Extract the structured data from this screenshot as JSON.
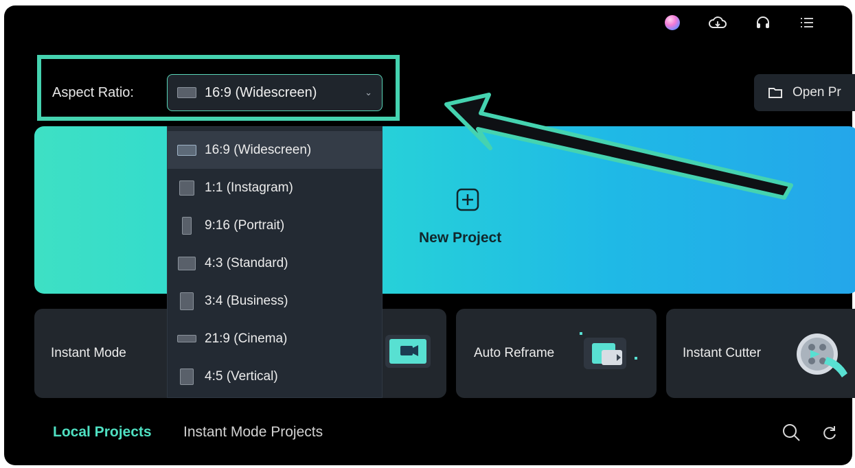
{
  "toolbar": {
    "icons": [
      "avatar",
      "cloud-icon",
      "headset-icon",
      "menu-icon"
    ]
  },
  "aspect": {
    "label": "Aspect Ratio:",
    "selected": "16:9 (Widescreen)"
  },
  "open_project": {
    "label": "Open Pr"
  },
  "new_project": {
    "label": "New Project"
  },
  "dropdown": {
    "options": [
      "16:9 (Widescreen)",
      "1:1 (Instagram)",
      "9:16 (Portrait)",
      "4:3 (Standard)",
      "3:4 (Business)",
      "21:9 (Cinema)",
      "4:5 (Vertical)"
    ]
  },
  "cards": [
    {
      "label": "Instant Mode"
    },
    {
      "label": "Auto Reframe"
    },
    {
      "label": "Instant Cutter"
    }
  ],
  "tabs": {
    "local": "Local Projects",
    "instant": "Instant Mode Projects"
  },
  "colors": {
    "accent": "#45d3b0",
    "banner_start": "#3ee0c4",
    "banner_end": "#24a6ea",
    "app_bg": "#000000",
    "card_bg": "#22272d"
  }
}
